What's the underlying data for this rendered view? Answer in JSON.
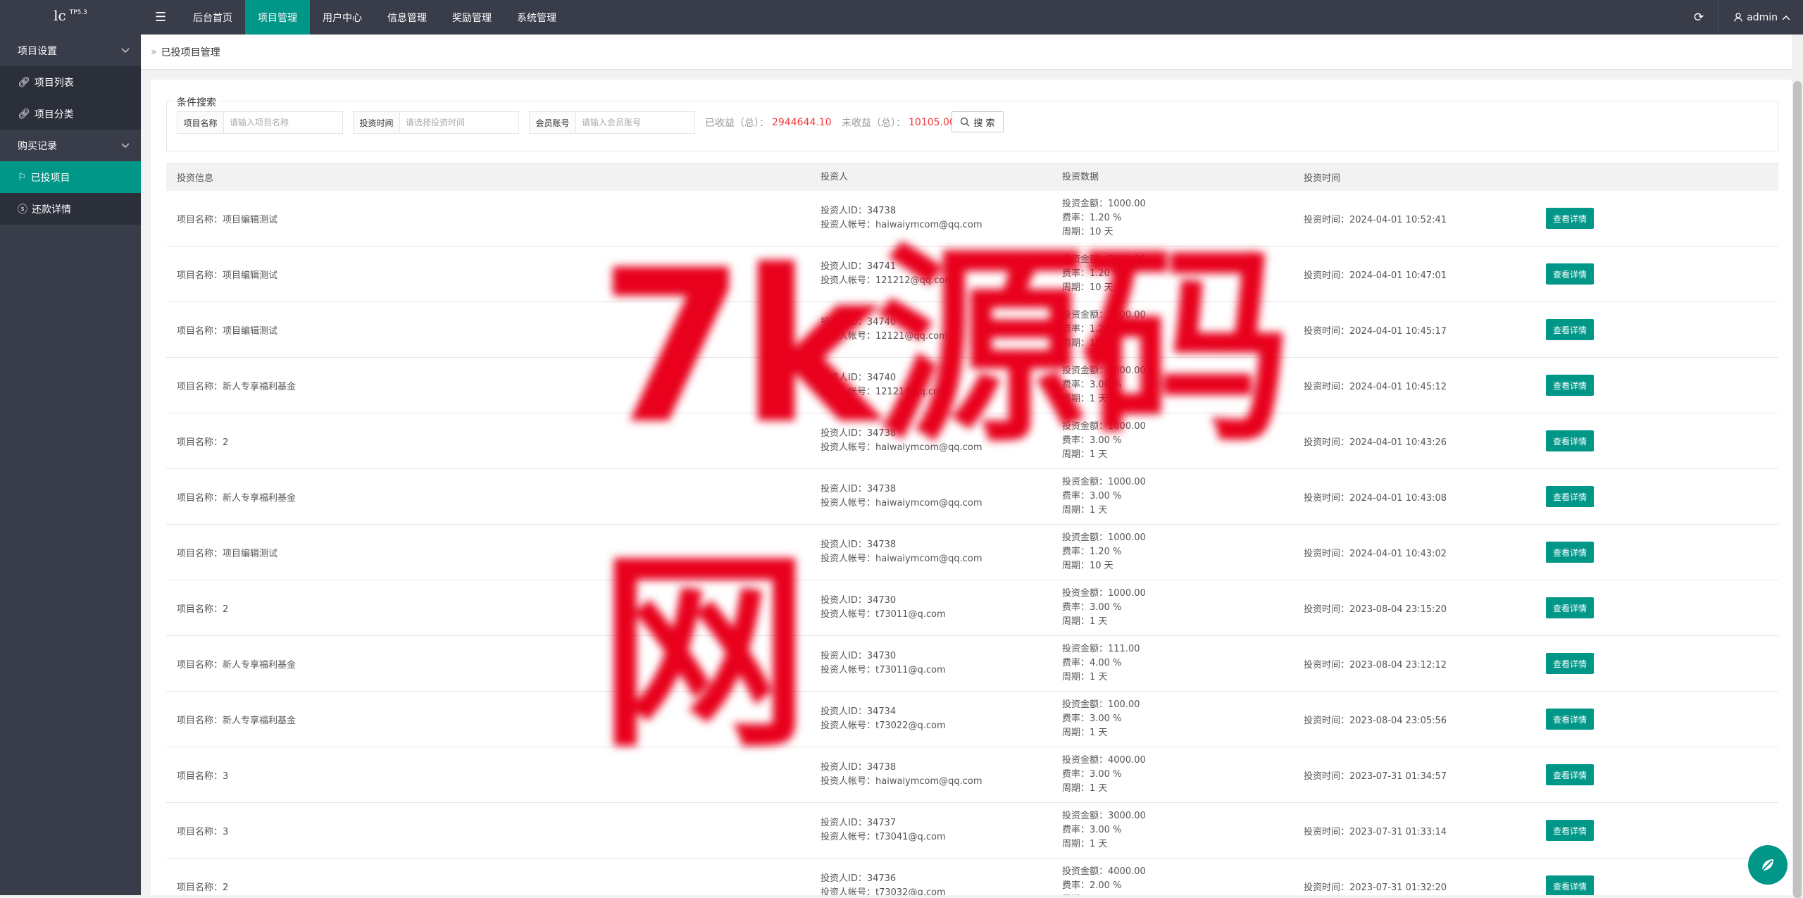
{
  "app": {
    "logo_main": "lc",
    "logo_sub": "TP5.3"
  },
  "topnav": {
    "items": [
      {
        "label": "后台首页",
        "active": false
      },
      {
        "label": "项目管理",
        "active": true
      },
      {
        "label": "用户中心",
        "active": false
      },
      {
        "label": "信息管理",
        "active": false
      },
      {
        "label": "奖励管理",
        "active": false
      },
      {
        "label": "系统管理",
        "active": false
      }
    ],
    "user": "admin"
  },
  "sidebar": {
    "groups": [
      {
        "label": "项目设置"
      },
      {
        "label": "购买记录"
      }
    ],
    "items": [
      {
        "label": "项目列表",
        "icon": "link-icon"
      },
      {
        "label": "项目分类",
        "icon": "link-icon"
      },
      {
        "label": "已投项目",
        "icon": "flag-icon",
        "active": true
      },
      {
        "label": "还款详情",
        "icon": "coin-icon"
      }
    ]
  },
  "breadcrumb": {
    "current": "已投项目管理"
  },
  "search": {
    "legend": "条件搜索",
    "project_name_label": "项目名称",
    "project_name_placeholder": "请输入项目名称",
    "invest_time_label": "投资时间",
    "invest_time_placeholder": "请选择投资时间",
    "member_label": "会员账号",
    "member_placeholder": "请输入会员账号",
    "earned_label": "已收益（总）：",
    "earned_value": "2944644.10",
    "unearned_label": "未收益（总）：",
    "unearned_value": "10105.00",
    "button_label": "搜 索"
  },
  "table": {
    "headers": [
      "投资信息",
      "投资人",
      "投资数据",
      "投资时间"
    ],
    "view_label": "查看详情",
    "rows": [
      {
        "project": "项目名称：项目编辑测试",
        "investor_id": "投资人ID：34738",
        "investor_account": "投资人帐号：haiwaiymcom@qq.com",
        "amount": "投资金额：1000.00",
        "rate": "费率：1.20 %",
        "period": "周期：10 天",
        "time": "投资时间：2024-04-01 10:52:41"
      },
      {
        "project": "项目名称：项目编辑测试",
        "investor_id": "投资人ID：34741",
        "investor_account": "投资人帐号：121212@qq.com",
        "amount": "投资金额：5000.00",
        "rate": "费率：1.20 %",
        "period": "周期：10 天",
        "time": "投资时间：2024-04-01 10:47:01"
      },
      {
        "project": "项目名称：项目编辑测试",
        "investor_id": "投资人ID：34740",
        "investor_account": "投资人帐号：12121@qq.com",
        "amount": "投资金额：1000.00",
        "rate": "费率：1.20 %",
        "period": "周期：10 天",
        "time": "投资时间：2024-04-01 10:45:17"
      },
      {
        "project": "项目名称：新人专享福利基金",
        "investor_id": "投资人ID：34740",
        "investor_account": "投资人帐号：12121@qq.com",
        "amount": "投资金额：1000.00",
        "rate": "费率：3.00 %",
        "period": "周期：1 天",
        "time": "投资时间：2024-04-01 10:45:12"
      },
      {
        "project": "项目名称：2",
        "investor_id": "投资人ID：34738",
        "investor_account": "投资人帐号：haiwaiymcom@qq.com",
        "amount": "投资金额：1000.00",
        "rate": "费率：3.00 %",
        "period": "周期：1 天",
        "time": "投资时间：2024-04-01 10:43:26"
      },
      {
        "project": "项目名称：新人专享福利基金",
        "investor_id": "投资人ID：34738",
        "investor_account": "投资人帐号：haiwaiymcom@qq.com",
        "amount": "投资金额：1000.00",
        "rate": "费率：3.00 %",
        "period": "周期：1 天",
        "time": "投资时间：2024-04-01 10:43:08"
      },
      {
        "project": "项目名称：项目编辑测试",
        "investor_id": "投资人ID：34738",
        "investor_account": "投资人帐号：haiwaiymcom@qq.com",
        "amount": "投资金额：1000.00",
        "rate": "费率：1.20 %",
        "period": "周期：10 天",
        "time": "投资时间：2024-04-01 10:43:02"
      },
      {
        "project": "项目名称：2",
        "investor_id": "投资人ID：34730",
        "investor_account": "投资人帐号：t73011@q.com",
        "amount": "投资金额：1000.00",
        "rate": "费率：3.00 %",
        "period": "周期：1 天",
        "time": "投资时间：2023-08-04 23:15:20"
      },
      {
        "project": "项目名称：新人专享福利基金",
        "investor_id": "投资人ID：34730",
        "investor_account": "投资人帐号：t73011@q.com",
        "amount": "投资金额：111.00",
        "rate": "费率：4.00 %",
        "period": "周期：1 天",
        "time": "投资时间：2023-08-04 23:12:12"
      },
      {
        "project": "项目名称：新人专享福利基金",
        "investor_id": "投资人ID：34734",
        "investor_account": "投资人帐号：t73022@q.com",
        "amount": "投资金额：100.00",
        "rate": "费率：3.00 %",
        "period": "周期：1 天",
        "time": "投资时间：2023-08-04 23:05:56"
      },
      {
        "project": "项目名称：3",
        "investor_id": "投资人ID：34738",
        "investor_account": "投资人帐号：haiwaiymcom@qq.com",
        "amount": "投资金额：4000.00",
        "rate": "费率：3.00 %",
        "period": "周期：1 天",
        "time": "投资时间：2023-07-31 01:34:57"
      },
      {
        "project": "项目名称：3",
        "investor_id": "投资人ID：34737",
        "investor_account": "投资人帐号：t73041@q.com",
        "amount": "投资金额：3000.00",
        "rate": "费率：3.00 %",
        "period": "周期：1 天",
        "time": "投资时间：2023-07-31 01:33:14"
      },
      {
        "project": "项目名称：2",
        "investor_id": "投资人ID：34736",
        "investor_account": "投资人帐号：t73032@q.com",
        "amount": "投资金额：4000.00",
        "rate": "费率：2.00 %",
        "period": "周期：1 天",
        "time": "投资时间：2023-07-31 01:32:20"
      }
    ]
  },
  "watermark": {
    "text": "7k源码网"
  },
  "colors": {
    "accent": "#009688",
    "topbar": "#393d49",
    "highlight": "#f1383d"
  }
}
